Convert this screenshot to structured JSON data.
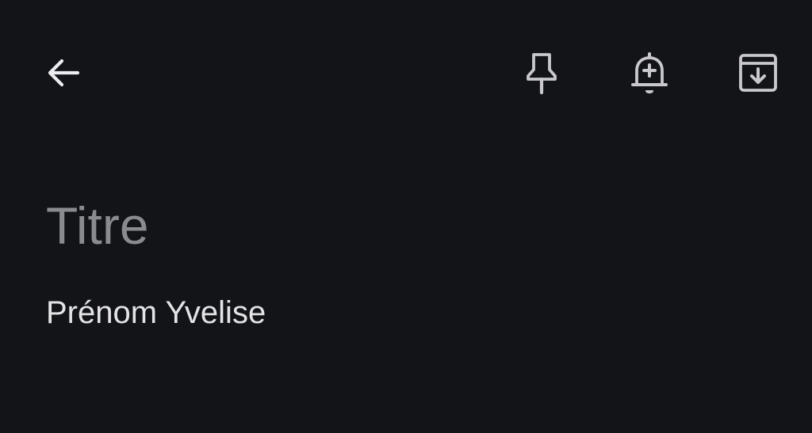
{
  "toolbar": {
    "back_icon": "arrow-back-icon",
    "pin_icon": "pin-icon",
    "reminder_icon": "bell-plus-icon",
    "archive_icon": "archive-icon",
    "icon_color": "#c9c8cc"
  },
  "note": {
    "title_placeholder": "Titre",
    "title_value": "",
    "body_text": "Prénom Yvelise"
  },
  "colors": {
    "background": "#131417",
    "placeholder": "#8a8b8e",
    "text": "#e4e3e6"
  }
}
